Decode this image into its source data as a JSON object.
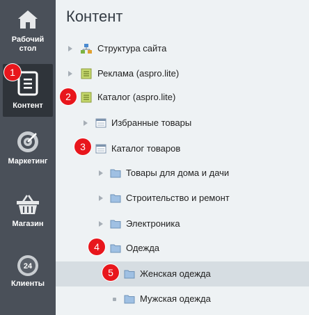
{
  "sidebar": {
    "items": [
      {
        "label_line1": "Рабочий",
        "label_line2": "стол",
        "icon": "home-icon"
      },
      {
        "label": "Контент",
        "icon": "document-icon",
        "active": true
      },
      {
        "label": "Маркетинг",
        "icon": "target-icon"
      },
      {
        "label": "Магазин",
        "icon": "basket-icon"
      },
      {
        "label": "Клиенты",
        "icon": "clock-24-icon"
      }
    ]
  },
  "main": {
    "title": "Контент",
    "tree": [
      {
        "label": "Структура сайта",
        "icon": "site-structure-icon"
      },
      {
        "label": "Реклама (aspro.lite)",
        "icon": "iblock-type-icon"
      },
      {
        "label": "Каталог (aspro.lite)",
        "icon": "iblock-type-icon"
      },
      {
        "label": "Избранные товары",
        "icon": "iblock-list-icon"
      },
      {
        "label": "Каталог товаров",
        "icon": "iblock-list-icon"
      },
      {
        "label": "Товары для дома и дачи",
        "icon": "folder-icon"
      },
      {
        "label": "Строительство и ремонт",
        "icon": "folder-icon"
      },
      {
        "label": "Электроника",
        "icon": "folder-icon"
      },
      {
        "label": "Одежда",
        "icon": "folder-icon"
      },
      {
        "label": "Женская одежда",
        "icon": "folder-icon",
        "selected": true
      },
      {
        "label": "Мужская одежда",
        "icon": "folder-icon"
      }
    ]
  },
  "badges": [
    "1",
    "2",
    "3",
    "4",
    "5"
  ],
  "colors": {
    "sidebar": "#4a5059",
    "sidebar_active": "#2f343a",
    "badge": "#e8161c",
    "folder": "#9fc0e3"
  }
}
